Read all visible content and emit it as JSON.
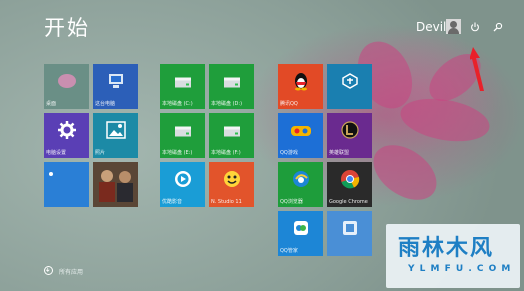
{
  "header": {
    "title": "开始",
    "user_name": "Devil"
  },
  "tiles": [
    {
      "label": "桌面",
      "color": "#6a8f86",
      "icon": "desktop-photo-icon"
    },
    {
      "label": "这台电脑",
      "color": "#2c5fb8",
      "icon": "computer-icon"
    },
    {
      "label": "电脑设置",
      "color": "#5a3fb5",
      "icon": "gear-icon"
    },
    {
      "label": "照片",
      "color": "#1c8aa6",
      "icon": "photos-icon"
    },
    {
      "label": "",
      "color": "#2a7fd6",
      "icon": "weather-icon"
    },
    {
      "label": "",
      "color": "#3a2a1c",
      "icon": "news-photo-icon"
    },
    {
      "label": "本地磁盘 (C:)",
      "color": "#1f9e3b",
      "icon": "drive-icon"
    },
    {
      "label": "本地磁盘 (D:)",
      "color": "#1f9e3b",
      "icon": "drive-icon"
    },
    {
      "label": "本地磁盘 (E:)",
      "color": "#1f9e3b",
      "icon": "drive-icon"
    },
    {
      "label": "本地磁盘 (F:)",
      "color": "#1f9e3b",
      "icon": "drive-icon"
    },
    {
      "label": "优酷影音",
      "color": "#1a9dd6",
      "icon": "youku-icon"
    },
    {
      "label": "N. Studio 11",
      "color": "#e2542b",
      "icon": "studio-icon"
    },
    {
      "label": "腾讯QQ",
      "color": "#e24a26",
      "icon": "qq-penguin-icon"
    },
    {
      "label": "",
      "color": "#1a7fb0",
      "icon": "cube-icon"
    },
    {
      "label": "QQ游戏",
      "color": "#1d6fd6",
      "icon": "qq-game-icon"
    },
    {
      "label": "英雄联盟",
      "color": "#6a2a8f",
      "icon": "league-icon"
    },
    {
      "label": "QQ浏览器",
      "color": "#1e9d3b",
      "icon": "qq-browser-icon"
    },
    {
      "label": "Google Chrome",
      "color": "#2a2a2a",
      "icon": "chrome-icon"
    },
    {
      "label": "QQ管家",
      "color": "#1d86d6",
      "icon": "qq-manager-icon"
    },
    {
      "label": "",
      "color": "#4a8fd6",
      "icon": "app-icon"
    }
  ],
  "footer": {
    "all_apps_label": "所有应用",
    "all_apps_icon": "arrow-down-circle-icon"
  },
  "watermark": {
    "main": "雨林木风",
    "sub": "Y L M F U . C O M"
  }
}
